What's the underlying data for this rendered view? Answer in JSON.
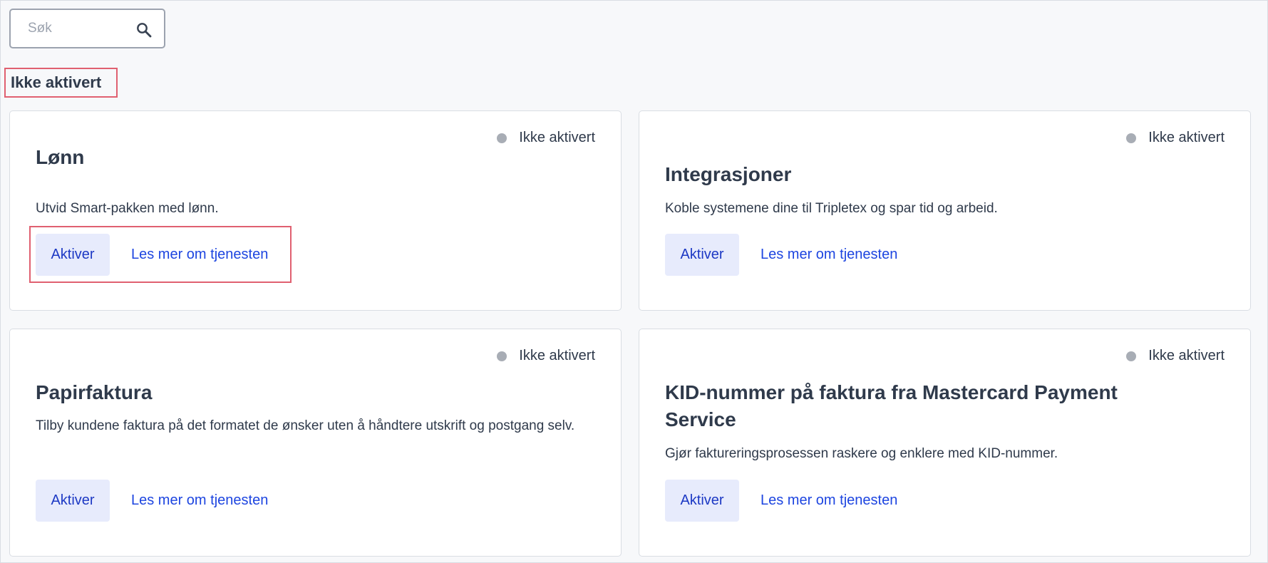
{
  "search": {
    "placeholder": "Søk",
    "value": ""
  },
  "section": {
    "title": "Ikke aktivert"
  },
  "cards": [
    {
      "status": "Ikke aktivert",
      "title": "Lønn",
      "description": "Utvid Smart-pakken med lønn.",
      "activate_label": "Aktiver",
      "more_label": "Les mer om tjenesten"
    },
    {
      "status": "Ikke aktivert",
      "title": "Integrasjoner",
      "description": "Koble systemene dine til Tripletex og spar tid og arbeid.",
      "activate_label": "Aktiver",
      "more_label": "Les mer om tjenesten"
    },
    {
      "status": "Ikke aktivert",
      "title": "Papirfaktura",
      "description": "Tilby kundene faktura på det formatet de ønsker uten å håndtere utskrift og postgang selv.",
      "activate_label": "Aktiver",
      "more_label": "Les mer om tjenesten"
    },
    {
      "status": "Ikke aktivert",
      "title": "KID-nummer på faktura fra Mastercard Payment Service",
      "description": "Gjør faktureringsprosessen raskere og enklere med KID-nummer.",
      "activate_label": "Aktiver",
      "more_label": "Les mer om tjenesten"
    }
  ],
  "colors": {
    "accent": "#1d45e0",
    "button_bg": "#e7ebfc",
    "status_dot": "#a8adb5",
    "highlight": "#e06070"
  }
}
